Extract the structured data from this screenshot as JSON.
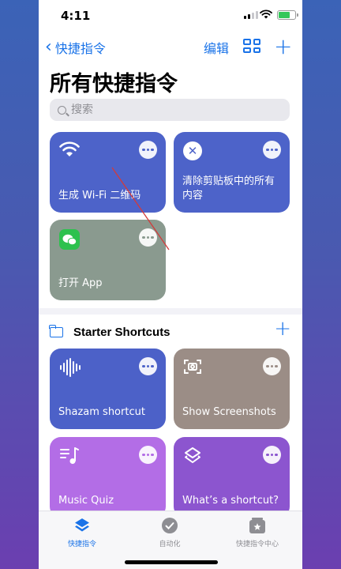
{
  "status": {
    "time": "4:11"
  },
  "nav": {
    "back_label": "快捷指令",
    "edit_label": "编辑",
    "add_label": "+"
  },
  "page": {
    "title": "所有快捷指令"
  },
  "search": {
    "placeholder": "搜索"
  },
  "shortcuts": [
    {
      "label": "生成 Wi-Fi 二维码",
      "icon": "wifi-icon",
      "color": "#4d63c9"
    },
    {
      "label": "清除剪贴板中的所有内容",
      "icon": "x-circle-icon",
      "color": "#4d63c9"
    },
    {
      "label": "打开 App",
      "icon": "wechat-icon",
      "color": "#8a9a8f"
    }
  ],
  "starter": {
    "title": "Starter Shortcuts",
    "add_label": "+",
    "items": [
      {
        "label": "Shazam shortcut",
        "icon": "waveform-icon",
        "color": "#4c61c8"
      },
      {
        "label": "Show Screenshots",
        "icon": "screenshot-icon",
        "color": "#9b8d86"
      },
      {
        "label": "Music Quiz",
        "icon": "music-list-icon",
        "color": "#b36de6"
      },
      {
        "label": "What’s a shortcut?",
        "icon": "layers-icon",
        "color": "#8c55cf"
      }
    ]
  },
  "tabs": [
    {
      "label": "快捷指令",
      "icon": "shortcuts-stack-icon",
      "active": true
    },
    {
      "label": "自动化",
      "icon": "clock-check-icon",
      "active": false
    },
    {
      "label": "快捷指令中心",
      "icon": "gallery-icon",
      "active": false
    }
  ],
  "colors": {
    "accent": "#1a73e8",
    "annotation": "#d23b3b"
  }
}
